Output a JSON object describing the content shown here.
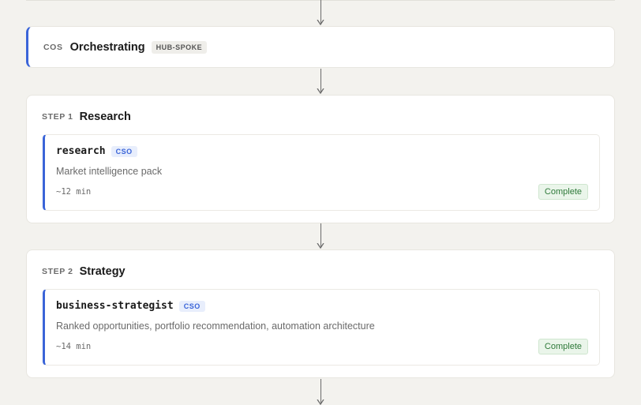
{
  "orchestrator": {
    "role": "COS",
    "title": "Orchestrating",
    "mode_tag": "HUB-SPOKE"
  },
  "steps": [
    {
      "label": "STEP 1",
      "title": "Research",
      "agent": {
        "name": "research",
        "owner_tag": "CSO",
        "description": "Market intelligence pack",
        "duration": "~12 min",
        "status": "Complete"
      }
    },
    {
      "label": "STEP 2",
      "title": "Strategy",
      "agent": {
        "name": "business-strategist",
        "owner_tag": "CSO",
        "description": "Ranked opportunities, portfolio recommendation, automation architecture",
        "duration": "~14 min",
        "status": "Complete"
      }
    }
  ],
  "colors": {
    "accent": "#3a64d8",
    "status_complete": "#2f7a3a",
    "background": "#f3f2ee"
  },
  "icons": {
    "connector": "arrow-down-icon"
  }
}
